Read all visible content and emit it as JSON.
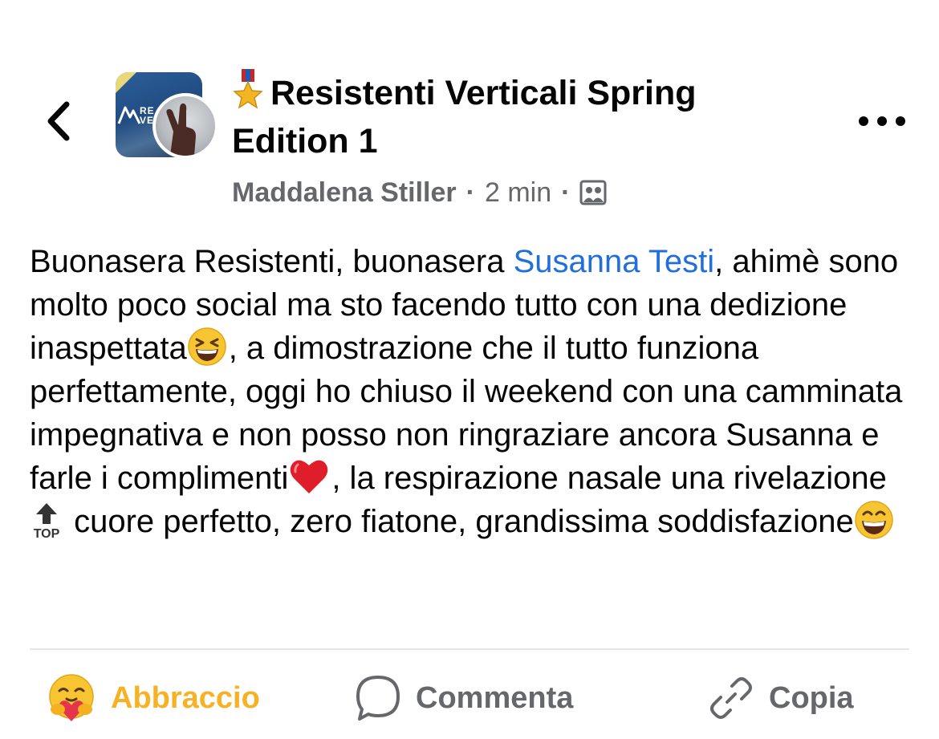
{
  "header": {
    "back_icon": "chevron-left-icon",
    "group_title": "Resistenti Verticali Spring Edition 1",
    "title_icon": "military-medal-icon",
    "group_avatar_text": "RE\nVE",
    "author": "Maddalena Stiller",
    "separator": "·",
    "time": "2 min",
    "audience_icon": "group-audience-icon",
    "more_icon": "more-dots-icon"
  },
  "post": {
    "text_1": "Buonasera Resistenti, buonasera ",
    "mention": "Susanna Testi",
    "text_2": ", ahimè sono molto poco social ma sto facendo tutto con una dedizione inaspettata",
    "emoji_1": "grinning-squinting-face-icon",
    "text_3": ", a dimostrazione che il tutto funziona perfettamente, oggi ho chiuso il weekend con una camminata impegnativa e non posso non ringraziare ancora Susanna e farle i complimenti",
    "emoji_2": "red-heart-icon",
    "text_4": ", la respirazione nasale una rivelazione ",
    "emoji_3": "top-arrow-icon",
    "text_5": " cuore perfetto, zero fiatone, grandissima soddisfazione",
    "emoji_4": "grinning-face-icon"
  },
  "actions": {
    "hug_label": "Abbraccio",
    "hug_icon": "hug-face-icon",
    "comment_label": "Commenta",
    "comment_icon": "speech-bubble-icon",
    "copy_label": "Copia",
    "copy_icon": "link-icon"
  },
  "colors": {
    "text": "#050505",
    "secondary": "#65676b",
    "mention": "#216fdb",
    "hug": "#f7b125",
    "divider": "#e4e6eb"
  }
}
